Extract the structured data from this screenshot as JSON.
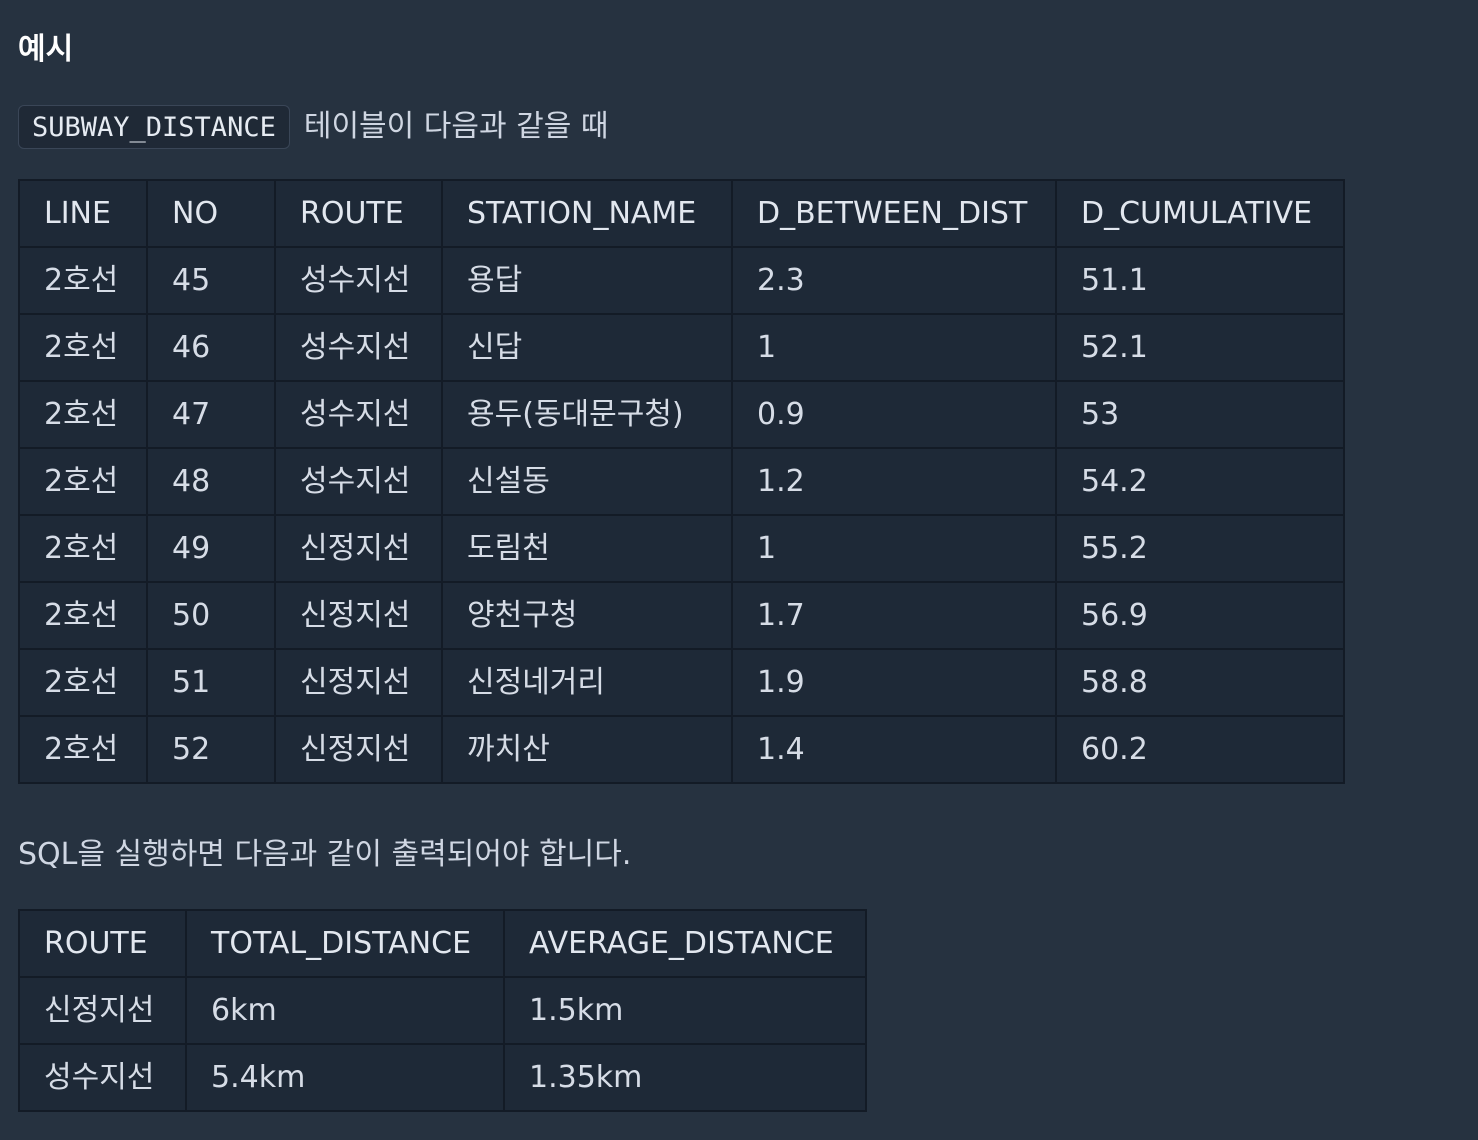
{
  "heading": "예시",
  "intro": {
    "code": "SUBWAY_DISTANCE",
    "text": "테이블이 다음과 같을 때"
  },
  "source_table": {
    "columns": [
      "LINE",
      "NO",
      "ROUTE",
      "STATION_NAME",
      "D_BETWEEN_DIST",
      "D_CUMULATIVE"
    ],
    "rows": [
      [
        "2호선",
        "45",
        "성수지선",
        "용답",
        "2.3",
        "51.1"
      ],
      [
        "2호선",
        "46",
        "성수지선",
        "신답",
        "1",
        "52.1"
      ],
      [
        "2호선",
        "47",
        "성수지선",
        "용두(동대문구청)",
        "0.9",
        "53"
      ],
      [
        "2호선",
        "48",
        "성수지선",
        "신설동",
        "1.2",
        "54.2"
      ],
      [
        "2호선",
        "49",
        "신정지선",
        "도림천",
        "1",
        "55.2"
      ],
      [
        "2호선",
        "50",
        "신정지선",
        "양천구청",
        "1.7",
        "56.9"
      ],
      [
        "2호선",
        "51",
        "신정지선",
        "신정네거리",
        "1.9",
        "58.8"
      ],
      [
        "2호선",
        "52",
        "신정지선",
        "까치산",
        "1.4",
        "60.2"
      ]
    ]
  },
  "mid_text": "SQL을 실행하면 다음과 같이 출력되어야 합니다.",
  "result_table": {
    "columns": [
      "ROUTE",
      "TOTAL_DISTANCE",
      "AVERAGE_DISTANCE"
    ],
    "rows": [
      [
        "신정지선",
        "6km",
        "1.5km"
      ],
      [
        "성수지선",
        "5.4km",
        "1.35km"
      ]
    ]
  }
}
